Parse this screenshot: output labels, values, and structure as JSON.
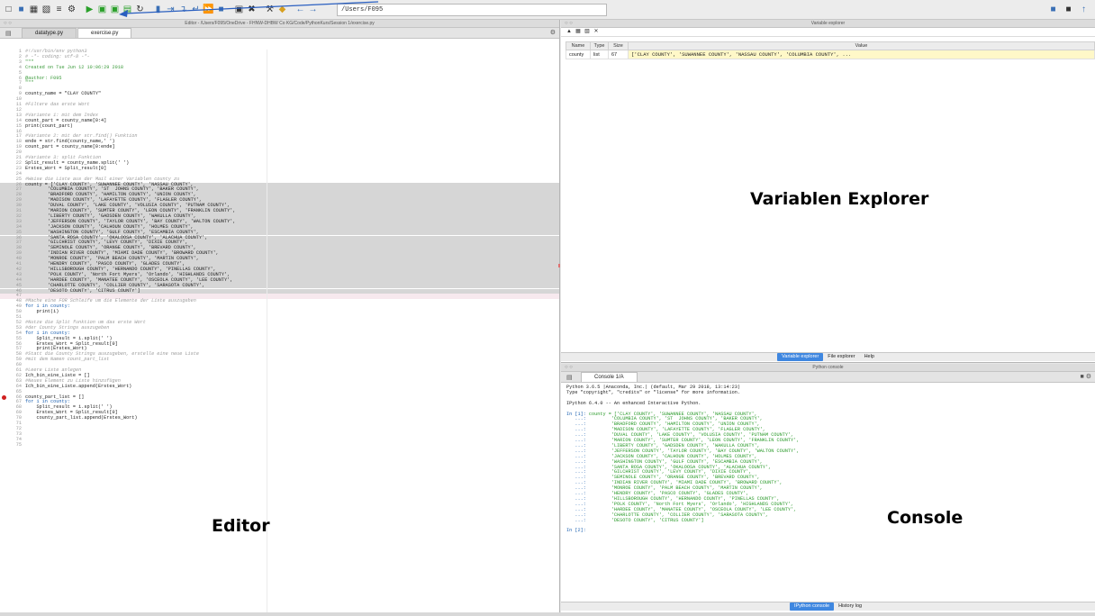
{
  "toolbar": {
    "path": "/Users/F095"
  },
  "editor": {
    "title": "Editor - /Users/F095/OneDrive - FHNW-DHBW Co KG/Code/PythonKurs/Session 1/exercise.py",
    "tabs": [
      {
        "label": "datatype.py"
      },
      {
        "label": "exercise.py"
      }
    ],
    "lines": [
      {
        "t": "#!/usr/bin/env python3",
        "k": "comment"
      },
      {
        "t": "# -*- coding: utf-8 -*-",
        "k": "comment"
      },
      {
        "t": "\"\"\"",
        "k": "doc"
      },
      {
        "t": "Created on Tue Jun 12 10:06:29 2018",
        "k": "doc"
      },
      {
        "t": "",
        "k": "doc"
      },
      {
        "t": "@author: F095",
        "k": "doc"
      },
      {
        "t": "\"\"\"",
        "k": "doc"
      },
      {
        "t": "",
        "k": ""
      },
      {
        "t": "county_name = \"CLAY COUNTY\"",
        "k": ""
      },
      {
        "t": "",
        "k": ""
      },
      {
        "t": "#Filtere das erste Wort",
        "k": "comment"
      },
      {
        "t": "",
        "k": ""
      },
      {
        "t": "#Variante 1: mit dem Index",
        "k": "comment"
      },
      {
        "t": "count_part = county_name[0:4]",
        "k": ""
      },
      {
        "t": "print(count_part)",
        "k": ""
      },
      {
        "t": "",
        "k": ""
      },
      {
        "t": "#Variante 2: mit der str.find() Funktion",
        "k": "comment"
      },
      {
        "t": "ende = str.find(county_name,' ')",
        "k": ""
      },
      {
        "t": "count_part = county_name[0:ende]",
        "k": ""
      },
      {
        "t": "",
        "k": ""
      },
      {
        "t": "#Variante 3: split Funktion",
        "k": "comment"
      },
      {
        "t": "Split_result = county_name.split(' ')",
        "k": ""
      },
      {
        "t": "Erstes_Wort = Split_result[0]",
        "k": ""
      },
      {
        "t": "",
        "k": ""
      },
      {
        "t": "#Weise die Liste aus der Mail einer Variablen county zu",
        "k": "comment"
      },
      {
        "t": "county = ['CLAY COUNTY', 'SUWANNEE COUNTY', 'NASSAU COUNTY',",
        "k": "sel"
      },
      {
        "t": "        'COLUMBIA COUNTY', 'ST  JOHNS COUNTY', 'BAKER COUNTY',",
        "k": "sel"
      },
      {
        "t": "        'BRADFORD COUNTY', 'HAMILTON COUNTY', 'UNION COUNTY',",
        "k": "sel"
      },
      {
        "t": "        'MADISON COUNTY', 'LAFAYETTE COUNTY', 'FLAGLER COUNTY',",
        "k": "sel"
      },
      {
        "t": "        'DUVAL COUNTY', 'LAKE COUNTY', 'VOLUSIA COUNTY', 'PUTNAM COUNTY',",
        "k": "sel"
      },
      {
        "t": "        'MARION COUNTY', 'SUMTER COUNTY', 'LEON COUNTY', 'FRANKLIN COUNTY',",
        "k": "sel"
      },
      {
        "t": "        'LIBERTY COUNTY', 'GADSDEN COUNTY', 'WAKULLA COUNTY',",
        "k": "sel"
      },
      {
        "t": "        'JEFFERSON COUNTY', 'TAYLOR COUNTY', 'BAY COUNTY', 'WALTON COUNTY',",
        "k": "sel"
      },
      {
        "t": "        'JACKSON COUNTY', 'CALHOUN COUNTY', 'HOLMES COUNTY',",
        "k": "sel"
      },
      {
        "t": "        'WASHINGTON COUNTY', 'GULF COUNTY', 'ESCAMBIA COUNTY',",
        "k": "sel"
      },
      {
        "t": "        'SANTA ROSA COUNTY', 'OKALOOSA COUNTY', 'ALACHUA COUNTY',",
        "k": "sel"
      },
      {
        "t": "        'GILCHRIST COUNTY', 'LEVY COUNTY', 'DIXIE COUNTY',",
        "k": "sel"
      },
      {
        "t": "        'SEMINOLE COUNTY', 'ORANGE COUNTY', 'BREVARD COUNTY',",
        "k": "sel"
      },
      {
        "t": "        'INDIAN RIVER COUNTY', 'MIAMI DADE COUNTY', 'BROWARD COUNTY',",
        "k": "sel"
      },
      {
        "t": "        'MONROE COUNTY', 'PALM BEACH COUNTY', 'MARTIN COUNTY',",
        "k": "sel"
      },
      {
        "t": "        'HENDRY COUNTY', 'PASCO COUNTY', 'GLADES COUNTY',",
        "k": "sel"
      },
      {
        "t": "        'HILLSBOROUGH COUNTY', 'HERNANDO COUNTY', 'PINELLAS COUNTY',",
        "k": "sel"
      },
      {
        "t": "        'POLK COUNTY', 'North Fort Myers', 'Orlando', 'HIGHLANDS COUNTY',",
        "k": "sel"
      },
      {
        "t": "        'HARDEE COUNTY', 'MANATEE COUNTY', 'OSCEOLA COUNTY', 'LEE COUNTY',",
        "k": "sel"
      },
      {
        "t": "        'CHARLOTTE COUNTY', 'COLLIER COUNTY', 'SARASOTA COUNTY',",
        "k": "sel"
      },
      {
        "t": "        'DESOTO COUNTY', 'CITRUS COUNTY']",
        "k": "sel"
      },
      {
        "t": "",
        "k": "cur"
      },
      {
        "t": "#Mache eine FOR Schleife um die Elemente der Liste auszugeben",
        "k": "comment"
      },
      {
        "t": "for i in county:",
        "k": "kw"
      },
      {
        "t": "    print(i)",
        "k": ""
      },
      {
        "t": "",
        "k": ""
      },
      {
        "t": "#Nutze die Split funktion um das erste Wort",
        "k": "comment"
      },
      {
        "t": "#der County Strings auszugeben",
        "k": "comment"
      },
      {
        "t": "for i in county:",
        "k": "kw"
      },
      {
        "t": "    Split_result = i.split(' ')",
        "k": ""
      },
      {
        "t": "    Erstes_Wort = Split_result[0]",
        "k": ""
      },
      {
        "t": "    print(Erstes_Wort)",
        "k": ""
      },
      {
        "t": "#Statt die County Strings auszugeben, erstelle eine neue Liste",
        "k": "comment"
      },
      {
        "t": "#mit dem Namen count_part_list",
        "k": "comment"
      },
      {
        "t": "",
        "k": ""
      },
      {
        "t": "#Leere Liste anlegen",
        "k": "comment"
      },
      {
        "t": "Ich_bin_eine_Liste = []",
        "k": ""
      },
      {
        "t": "#Neues Element zu Liste hinzufügen",
        "k": "comment"
      },
      {
        "t": "Ich_bin_eine_Liste.append(Erstes_Wort)",
        "k": ""
      },
      {
        "t": "",
        "k": ""
      },
      {
        "t": "county_part_list = []",
        "k": "bp"
      },
      {
        "t": "for i in county:",
        "k": "kw"
      },
      {
        "t": "    Split_result = i.split(' ')",
        "k": ""
      },
      {
        "t": "    Erstes_Wort = Split_result[0]",
        "k": ""
      },
      {
        "t": "    county_part_list.append(Erstes_Wort)",
        "k": ""
      },
      {
        "t": "",
        "k": ""
      },
      {
        "t": "",
        "k": ""
      },
      {
        "t": "",
        "k": ""
      },
      {
        "t": "",
        "k": ""
      },
      {
        "t": "",
        "k": ""
      }
    ]
  },
  "variable_explorer": {
    "title": "Variable explorer",
    "columns": [
      "Name",
      "Type",
      "Size",
      "Value"
    ],
    "rows": [
      {
        "name": "county",
        "type": "list",
        "size": "67",
        "value": "['CLAY COUNTY', 'SUWANNEE COUNTY', 'NASSAU COUNTY', 'COLUMBIA COUNTY', ..."
      }
    ],
    "tabs": [
      "Variable explorer",
      "File explorer",
      "Help"
    ]
  },
  "console": {
    "title": "Python console",
    "tab_label": "Console 1/A",
    "lines": [
      {
        "t": "Python 3.6.5 |Anaconda, Inc.| (default, Mar 29 2018, 13:14:23)",
        "k": ""
      },
      {
        "t": "Type \"copyright\", \"credits\" or \"license\" for more information.",
        "k": ""
      },
      {
        "t": "",
        "k": ""
      },
      {
        "t": "IPython 6.4.0 -- An enhanced Interactive Python.",
        "k": ""
      },
      {
        "t": "",
        "k": ""
      },
      {
        "p": "In [1]: ",
        "t": "county = ['CLAY COUNTY', 'SUWANNEE COUNTY', 'NASSAU COUNTY',",
        "k": "green"
      },
      {
        "p": "   ...: ",
        "t": "        'COLUMBIA COUNTY', 'ST  JOHNS COUNTY', 'BAKER COUNTY',",
        "k": "green"
      },
      {
        "p": "   ...: ",
        "t": "        'BRADFORD COUNTY', 'HAMILTON COUNTY', 'UNION COUNTY',",
        "k": "green"
      },
      {
        "p": "   ...: ",
        "t": "        'MADISON COUNTY', 'LAFAYETTE COUNTY', 'FLAGLER COUNTY',",
        "k": "green"
      },
      {
        "p": "   ...: ",
        "t": "        'DUVAL COUNTY', 'LAKE COUNTY', 'VOLUSIA COUNTY', 'PUTNAM COUNTY',",
        "k": "green"
      },
      {
        "p": "   ...: ",
        "t": "        'MARION COUNTY', 'SUMTER COUNTY', 'LEON COUNTY', 'FRANKLIN COUNTY',",
        "k": "green"
      },
      {
        "p": "   ...: ",
        "t": "        'LIBERTY COUNTY', 'GADSDEN COUNTY', 'WAKULLA COUNTY',",
        "k": "green"
      },
      {
        "p": "   ...: ",
        "t": "        'JEFFERSON COUNTY', 'TAYLOR COUNTY', 'BAY COUNTY', 'WALTON COUNTY',",
        "k": "green"
      },
      {
        "p": "   ...: ",
        "t": "        'JACKSON COUNTY', 'CALHOUN COUNTY', 'HOLMES COUNTY',",
        "k": "green"
      },
      {
        "p": "   ...: ",
        "t": "        'WASHINGTON COUNTY', 'GULF COUNTY', 'ESCAMBIA COUNTY',",
        "k": "green"
      },
      {
        "p": "   ...: ",
        "t": "        'SANTA ROSA COUNTY', 'OKALOOSA COUNTY', 'ALACHUA COUNTY',",
        "k": "green"
      },
      {
        "p": "   ...: ",
        "t": "        'GILCHRIST COUNTY', 'LEVY COUNTY', 'DIXIE COUNTY',",
        "k": "green"
      },
      {
        "p": "   ...: ",
        "t": "        'SEMINOLE COUNTY', 'ORANGE COUNTY', 'BREVARD COUNTY',",
        "k": "green"
      },
      {
        "p": "   ...: ",
        "t": "        'INDIAN RIVER COUNTY', 'MIAMI DADE COUNTY', 'BROWARD COUNTY',",
        "k": "green"
      },
      {
        "p": "   ...: ",
        "t": "        'MONROE COUNTY', 'PALM BEACH COUNTY', 'MARTIN COUNTY',",
        "k": "green"
      },
      {
        "p": "   ...: ",
        "t": "        'HENDRY COUNTY', 'PASCO COUNTY', 'GLADES COUNTY',",
        "k": "green"
      },
      {
        "p": "   ...: ",
        "t": "        'HILLSBOROUGH COUNTY', 'HERNANDO COUNTY', 'PINELLAS COUNTY',",
        "k": "green"
      },
      {
        "p": "   ...: ",
        "t": "        'POLK COUNTY', 'North Fort Myers', 'Orlando', 'HIGHLANDS COUNTY',",
        "k": "green"
      },
      {
        "p": "   ...: ",
        "t": "        'HARDEE COUNTY', 'MANATEE COUNTY', 'OSCEOLA COUNTY', 'LEE COUNTY',",
        "k": "green"
      },
      {
        "p": "   ...: ",
        "t": "        'CHARLOTTE COUNTY', 'COLLIER COUNTY', 'SARASOTA COUNTY',",
        "k": "green"
      },
      {
        "p": "   ...: ",
        "t": "        'DESOTO COUNTY', 'CITRUS COUNTY']",
        "k": "green"
      },
      {
        "t": "",
        "k": ""
      },
      {
        "p": "In [2]: ",
        "t": "",
        "k": "green"
      }
    ],
    "tabs": [
      "IPython console",
      "History log"
    ]
  },
  "overlay_labels": {
    "variables": "Variablen Explorer",
    "editor": "Editor",
    "console": "Console"
  }
}
